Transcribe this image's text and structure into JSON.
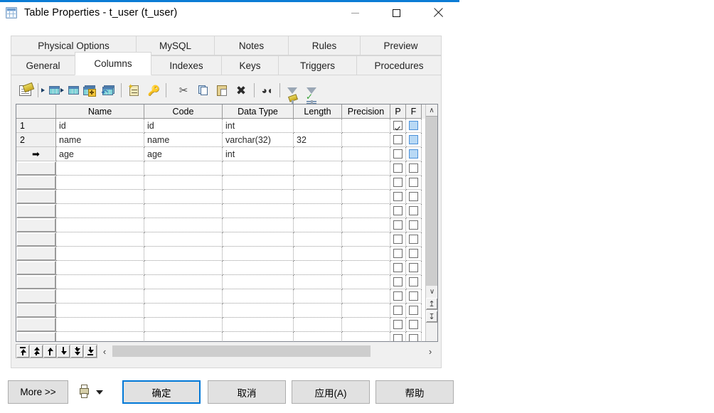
{
  "window": {
    "title": "Table Properties - t_user (t_user)",
    "icon": "table-icon",
    "accent_color": "#0c7cd5",
    "controls": {
      "minimize": "—",
      "maximize": "□",
      "close": "✕"
    }
  },
  "tabs": {
    "row1": [
      {
        "label": "Physical Options",
        "active": false
      },
      {
        "label": "MySQL",
        "active": false
      },
      {
        "label": "Notes",
        "active": false
      },
      {
        "label": "Rules",
        "active": false
      },
      {
        "label": "Preview",
        "active": false
      }
    ],
    "row2": [
      {
        "label": "General",
        "active": false
      },
      {
        "label": "Columns",
        "active": true
      },
      {
        "label": "Indexes",
        "active": false
      },
      {
        "label": "Keys",
        "active": false
      },
      {
        "label": "Triggers",
        "active": false
      },
      {
        "label": "Procedures",
        "active": false
      }
    ]
  },
  "toolbar": {
    "items": [
      {
        "name": "properties-icon",
        "tip": "Properties"
      },
      {
        "name": "insert-row-icon",
        "tip": "Insert a Row"
      },
      {
        "name": "insert-row-below-icon",
        "tip": "Insert a Row Below"
      },
      {
        "name": "add-row-icon",
        "tip": "Add a Row"
      },
      {
        "name": "replace-row-icon",
        "tip": "Replace Row"
      },
      {
        "name": "note-icon",
        "tip": "Column Notes"
      },
      {
        "name": "key-icon",
        "tip": "Primary Key"
      },
      {
        "name": "cut-icon",
        "tip": "Cut"
      },
      {
        "name": "copy-icon",
        "tip": "Copy"
      },
      {
        "name": "paste-icon",
        "tip": "Paste"
      },
      {
        "name": "delete-icon",
        "tip": "Delete"
      },
      {
        "name": "find-icon",
        "tip": "Find"
      },
      {
        "name": "customize-filter-icon",
        "tip": "Customize Columns and Filter"
      },
      {
        "name": "apply-filter-icon",
        "tip": "Apply Filter"
      }
    ]
  },
  "grid": {
    "headers": [
      "",
      "Name",
      "Code",
      "Data Type",
      "Length",
      "Precision",
      "P",
      "F"
    ],
    "rows": [
      {
        "num": "1",
        "current": false,
        "name": "id",
        "code": "id",
        "type": "int",
        "length": "",
        "precision": "",
        "p": true,
        "f_selected": true
      },
      {
        "num": "2",
        "current": false,
        "name": "name",
        "code": "name",
        "type": "varchar(32)",
        "length": "32",
        "precision": "",
        "p": false,
        "f_selected": true
      },
      {
        "num": "",
        "current": true,
        "name": "age",
        "code": "age",
        "type": "int",
        "length": "",
        "precision": "",
        "p": false,
        "f_selected": true
      }
    ],
    "empty_row_count": 13,
    "current_row_marker": "➡",
    "vscroll": {
      "up": "∧",
      "down": "∨",
      "top": "⤓",
      "bottom": "⤓"
    }
  },
  "grid_nav": {
    "buttons": [
      {
        "name": "nav-first",
        "glyph": "first"
      },
      {
        "name": "nav-prev-page",
        "glyph": "prev-page"
      },
      {
        "name": "nav-up",
        "glyph": "up"
      },
      {
        "name": "nav-down",
        "glyph": "down"
      },
      {
        "name": "nav-next-page",
        "glyph": "next-page"
      },
      {
        "name": "nav-last",
        "glyph": "last"
      }
    ],
    "hscroll": {
      "left": "‹",
      "right": "›"
    }
  },
  "footer": {
    "more": "More >>",
    "print_icon": "printer-icon",
    "ok": "确定",
    "cancel": "取消",
    "apply": "应用(A)",
    "help": "帮助"
  }
}
